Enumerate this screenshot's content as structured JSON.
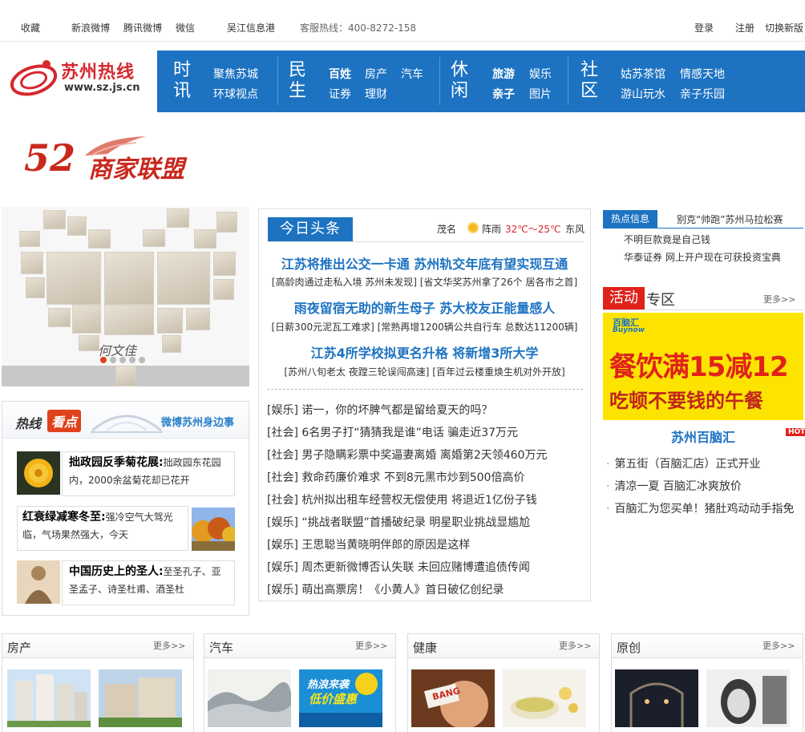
{
  "topbar": {
    "links": [
      "收藏",
      "新浪微博",
      "腾讯微博",
      "微信",
      "吴江信息港"
    ],
    "hotline": "客服热线：400-8272-158",
    "login": "登录",
    "register": "注册",
    "switch": "切换新版"
  },
  "logo": {
    "name": "苏州热线",
    "url": "www.sz.js.cn"
  },
  "nav": [
    {
      "big": [
        "时",
        "讯"
      ],
      "links": [
        [
          "聚焦苏城"
        ],
        [
          "环球视点"
        ]
      ]
    },
    {
      "big": [
        "民",
        "生"
      ],
      "links": [
        [
          "百姓",
          "房产",
          "汽车"
        ],
        [
          "证券",
          "理财"
        ]
      ]
    },
    {
      "big": [
        "休",
        "闲"
      ],
      "links": [
        [
          "旅游",
          "娱乐"
        ],
        [
          "亲子",
          "图片"
        ]
      ]
    },
    {
      "big": [
        "社",
        "区"
      ],
      "links": [
        [
          "姑苏茶馆",
          "情感天地"
        ],
        [
          "游山玩水",
          "亲子乐园"
        ]
      ]
    }
  ],
  "banner52": {
    "num": "52",
    "text": "商家联盟"
  },
  "collage": {
    "signature": "何文佳"
  },
  "hotbox": {
    "t1": "热线",
    "t2": "看点",
    "t3": "微博苏州身边事",
    "items": [
      {
        "title": "拙政园反季菊花展:",
        "text": "拙政园东花园内，2000余盆菊花却已花开"
      },
      {
        "title": "红衰绿减寒冬至:",
        "text": "强冷空气大驾光临，气场果然强大，今天"
      },
      {
        "title": "中国历史上的圣人:",
        "text": "至圣孔子、亚圣孟子、诗圣杜甫、酒圣杜"
      }
    ]
  },
  "news": {
    "tab": "今日头条",
    "weather": {
      "city": "茂名",
      "cond": "阵雨",
      "temp": "32℃～25℃",
      "wind": "东风"
    },
    "headlines": [
      {
        "title": "江苏将推出公交一卡通 苏州轨交年底有望实现互通",
        "sub": "[高龄肉通过走私入境 苏州未发现] [省文华奖苏州拿了26个 居各市之首]"
      },
      {
        "title": "雨夜留宿无助的新生母子 苏大校友正能量感人",
        "sub": "[日薪300元泥瓦工难求] [常熟再增1200辆公共自行车 总数达11200辆]"
      },
      {
        "title": "江苏4所学校拟更名升格 将新增3所大学",
        "sub": "[苏州八旬老太 夜蹚三轮误闯高速] [百年过云楼重焕生机对外开放]"
      }
    ],
    "items": [
      "[娱乐] 诺一，你的坏脾气都是留给夏天的吗？",
      "[社会] 6名男子打“猜猜我是谁”电话 骗走近37万元",
      "[社会] 男子隐瞒彩票中奖逼妻离婚 离婚第2天领460万元",
      "[社会] 救命药廉价难求 不到8元黑市炒到500倍高价",
      "[社会] 杭州拟出租车经营权无偿使用 将退近1亿份子钱",
      "[娱乐] “挑战者联盟”首播破纪录 明星职业挑战显尴尬",
      "[娱乐] 王思聪当黄晓明伴郎的原因是这样",
      "[娱乐] 周杰更新微博否认失联 未回应赌博遭追债传闻",
      "[娱乐] 萌出高票房！《小黄人》首日破亿创纪录"
    ]
  },
  "rhot": {
    "tab": "热点信息",
    "items": [
      "别克“帅跑”苏州马拉松赛",
      "不明巨款竟是自己钱",
      "华泰证券 网上开户现在可获投资宝典"
    ]
  },
  "act": {
    "tab": "活动",
    "tab2": "专区",
    "more": "更多>>",
    "ad": {
      "brand": "百脑汇",
      "brand2": "Buynow",
      "line1": "餐饮满15减12",
      "line2": "吃顿不要钱的午餐"
    },
    "title": "苏州百脑汇",
    "hot": "HOT",
    "items": [
      "第五街（百脑汇店）正式开业",
      "清凉一夏 百脑汇冰爽放价",
      "百脑汇为您买单！猪肚鸡动动手指免"
    ]
  },
  "sections": [
    {
      "title": "房产",
      "more": "更多>>"
    },
    {
      "title": "汽车",
      "more": "更多>>",
      "img2": {
        "l1": "热浪来袭",
        "l2": "低价盛惠"
      }
    },
    {
      "title": "健康",
      "more": "更多>>",
      "bang": "BANG"
    },
    {
      "title": "原创",
      "more": "更多>>"
    }
  ],
  "colors": {
    "brand_blue": "#1d73c2",
    "brand_red": "#e0221b"
  }
}
